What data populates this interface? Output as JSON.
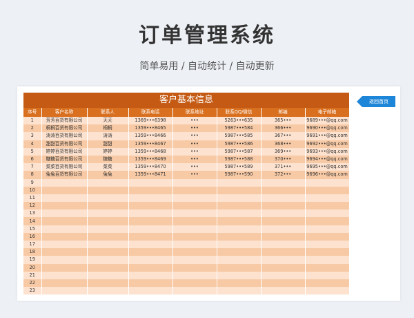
{
  "header": {
    "title": "订单管理系统",
    "subtitle": "简单易用  /  自动统计  /  自动更新"
  },
  "sheet": {
    "banner": "客户基本信息",
    "back_button": "返回首页",
    "columns": [
      "序号",
      "客户名称",
      "联系人",
      "联系电话",
      "联系地址",
      "联系QQ/微信",
      "邮编",
      "电子邮箱"
    ],
    "rows": [
      [
        "1",
        "芳芳百货有限公司",
        "天天",
        "1369•••6398",
        "•••",
        "5263•••635",
        "365•••",
        "9689•••@qq.com"
      ],
      [
        "2",
        "桐桐百货有限公司",
        "桐桐",
        "1359•••8465",
        "•••",
        "5987•••584",
        "366•••",
        "9690•••@qq.com"
      ],
      [
        "3",
        "涛涛百货有限公司",
        "涛涛",
        "1359•••8466",
        "•••",
        "5987•••585",
        "367•••",
        "9691•••@qq.com"
      ],
      [
        "4",
        "甜甜百货有限公司",
        "甜甜",
        "1359•••8467",
        "•••",
        "5987•••586",
        "368•••",
        "9692•••@qq.com"
      ],
      [
        "5",
        "婷婷百货有限公司",
        "婷婷",
        "1359•••8468",
        "•••",
        "5987•••587",
        "369•••",
        "9693•••@qq.com"
      ],
      [
        "6",
        "糖糖百货有限公司",
        "糖糖",
        "1359•••8469",
        "•••",
        "5987•••588",
        "370•••",
        "9694•••@qq.com"
      ],
      [
        "7",
        "菜菜百货有限公司",
        "菜菜",
        "1359•••8470",
        "•••",
        "5987•••589",
        "371•••",
        "9695•••@qq.com"
      ],
      [
        "8",
        "兔兔百货有限公司",
        "兔兔",
        "1359•••8471",
        "•••",
        "5987•••590",
        "372•••",
        "9696•••@qq.com"
      ],
      [
        "9",
        "",
        "",
        "",
        "",
        "",
        "",
        ""
      ],
      [
        "10",
        "",
        "",
        "",
        "",
        "",
        "",
        ""
      ],
      [
        "11",
        "",
        "",
        "",
        "",
        "",
        "",
        ""
      ],
      [
        "12",
        "",
        "",
        "",
        "",
        "",
        "",
        ""
      ],
      [
        "13",
        "",
        "",
        "",
        "",
        "",
        "",
        ""
      ],
      [
        "14",
        "",
        "",
        "",
        "",
        "",
        "",
        ""
      ],
      [
        "15",
        "",
        "",
        "",
        "",
        "",
        "",
        ""
      ],
      [
        "16",
        "",
        "",
        "",
        "",
        "",
        "",
        ""
      ],
      [
        "17",
        "",
        "",
        "",
        "",
        "",
        "",
        ""
      ],
      [
        "18",
        "",
        "",
        "",
        "",
        "",
        "",
        ""
      ],
      [
        "19",
        "",
        "",
        "",
        "",
        "",
        "",
        ""
      ],
      [
        "20",
        "",
        "",
        "",
        "",
        "",
        "",
        ""
      ],
      [
        "21",
        "",
        "",
        "",
        "",
        "",
        "",
        ""
      ],
      [
        "22",
        "",
        "",
        "",
        "",
        "",
        "",
        ""
      ],
      [
        "23",
        "",
        "",
        "",
        "",
        "",
        "",
        ""
      ]
    ]
  },
  "colors": {
    "banner": "#c45a14",
    "header_row": "#d9701f",
    "row_light": "#fde2cf",
    "row_dark": "#f7c9a5",
    "back_button": "#1e86d8"
  }
}
